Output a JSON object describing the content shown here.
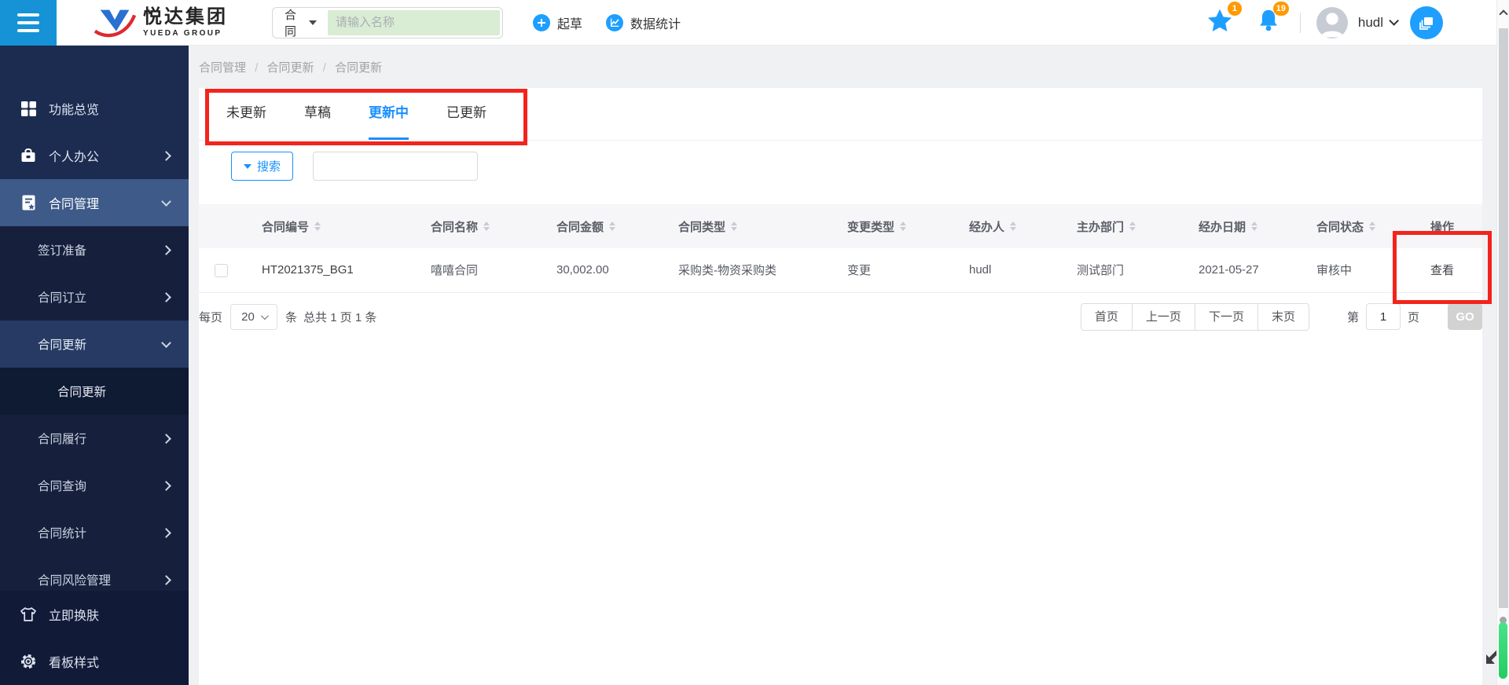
{
  "header": {
    "logo_title": "悦达集团",
    "logo_subtitle": "YUEDA GROUP",
    "search_category": "合同",
    "search_placeholder": "请输入名称",
    "draft_label": "起草",
    "stats_label": "数据统计",
    "favorites_badge": "1",
    "notifications_badge": "19",
    "username": "hudl"
  },
  "sidebar": {
    "items": [
      {
        "label": "功能总览"
      },
      {
        "label": "个人办公"
      },
      {
        "label": "合同管理"
      },
      {
        "label": "签订准备"
      },
      {
        "label": "合同订立"
      },
      {
        "label": "合同更新"
      },
      {
        "label": "合同更新"
      },
      {
        "label": "合同履行"
      },
      {
        "label": "合同查询"
      },
      {
        "label": "合同统计"
      },
      {
        "label": "合同风险管理"
      }
    ],
    "footer_items": [
      {
        "label": "立即换肤"
      },
      {
        "label": "看板样式"
      }
    ]
  },
  "breadcrumb": {
    "parts": [
      "合同管理",
      "合同更新",
      "合同更新"
    ],
    "separator": "/"
  },
  "tabs": [
    {
      "label": "未更新"
    },
    {
      "label": "草稿"
    },
    {
      "label": "更新中"
    },
    {
      "label": "已更新"
    }
  ],
  "filter": {
    "search_button": "搜索",
    "keyword_value": ""
  },
  "table": {
    "columns": [
      {
        "label": "合同编号"
      },
      {
        "label": "合同名称"
      },
      {
        "label": "合同金额"
      },
      {
        "label": "合同类型"
      },
      {
        "label": "变更类型"
      },
      {
        "label": "经办人"
      },
      {
        "label": "主办部门"
      },
      {
        "label": "经办日期"
      },
      {
        "label": "合同状态"
      },
      {
        "label": "操作"
      }
    ],
    "rows": [
      {
        "cells": [
          "HT2021375_BG1",
          "嘻嘻合同",
          "30,002.00",
          "采购类-物资采购类",
          "变更",
          "hudl",
          "测试部门",
          "2021-05-27",
          "审核中"
        ],
        "action": "查看"
      }
    ]
  },
  "pagination": {
    "per_page_label": "每页",
    "per_page_value": "20",
    "per_page_unit": "条",
    "summary": "总共 1 页 1 条",
    "first": "首页",
    "prev": "上一页",
    "next": "下一页",
    "last": "末页",
    "jump_prefix": "第",
    "jump_value": "1",
    "jump_unit": "页",
    "go_label": "GO"
  },
  "colors": {
    "accent_blue": "#1e9fff",
    "tab_active_blue": "#1890ff",
    "badge_orange": "#ff9a00",
    "annotation_red": "#f3241d",
    "sidebar_bg": "#1c2b50"
  }
}
